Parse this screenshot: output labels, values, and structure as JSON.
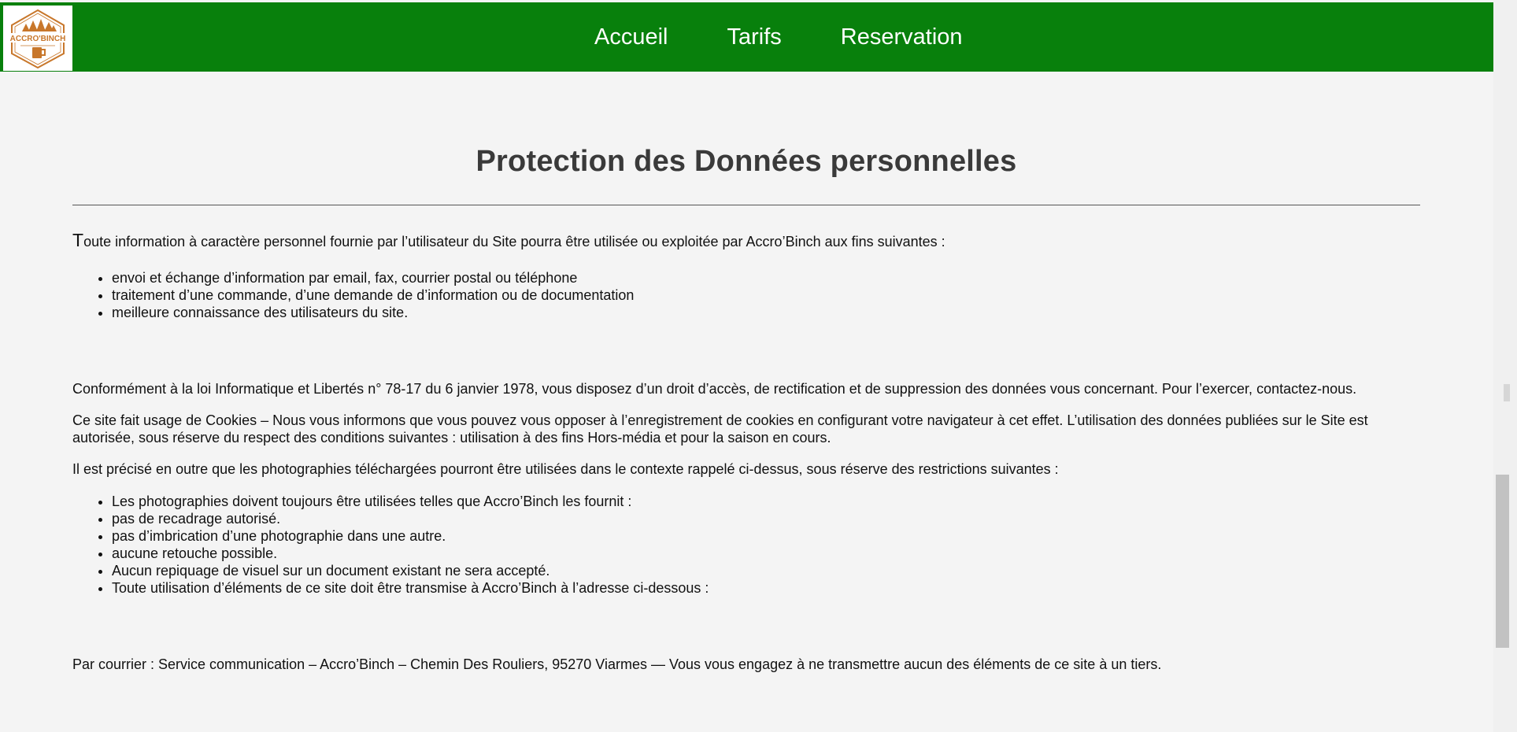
{
  "header": {
    "logo_text": "ACCRO'BINCH",
    "nav": [
      {
        "label": "Accueil"
      },
      {
        "label": "Tarifs"
      },
      {
        "label": "Reservation"
      }
    ],
    "colors": {
      "bar": "#08800c",
      "logo_accent": "#c8772b"
    }
  },
  "main": {
    "title": "Protection des Données personnelles",
    "intro_first_letter": "T",
    "intro_rest": "oute information à caractère personnel fournie par l’utilisateur du Site pourra être utilisée ou exploitée par Accro’Binch aux fins suivantes :",
    "purposes": [
      "envoi et échange d’information par email, fax, courrier postal ou téléphone",
      "traitement d’une commande, d’une demande de d’information ou de documentation",
      "meilleure connaissance des utilisateurs du site."
    ],
    "law_paragraph": "Conformément à la loi Informatique et Libertés n° 78-17 du 6 janvier 1978, vous disposez d’un droit d’accès, de rectification et de suppression des données vous concernant. Pour l’exercer, contactez-nous.",
    "cookies_paragraph": "Ce site fait usage de Cookies – Nous vous informons que vous pouvez vous opposer à l’enregistrement de cookies en configurant votre navigateur à cet effet. L’utilisation des données publiées sur le Site est autorisée, sous réserve du respect des conditions suivantes : utilisation à des fins Hors-média et pour la saison en cours.",
    "photos_paragraph": "Il est précisé en outre que les photographies téléchargées pourront être utilisées dans le contexte rappelé ci-dessus, sous réserve des restrictions suivantes :",
    "restrictions": [
      "Les photographies doivent toujours être utilisées telles que Accro’Binch les fournit :",
      "pas de recadrage autorisé.",
      "pas d’imbrication d’une photographie dans une autre.",
      "aucune retouche possible.",
      "Aucun repiquage de visuel sur un document existant ne sera accepté.",
      "Toute utilisation d’éléments de ce site doit être transmise à Accro’Binch à l’adresse ci-dessous :"
    ],
    "courrier_paragraph": "Par courrier : Service communication – Accro’Binch – Chemin Des Rouliers, 95270 Viarmes — Vous vous engagez à ne transmettre aucun des éléments de ce site à un tiers."
  }
}
